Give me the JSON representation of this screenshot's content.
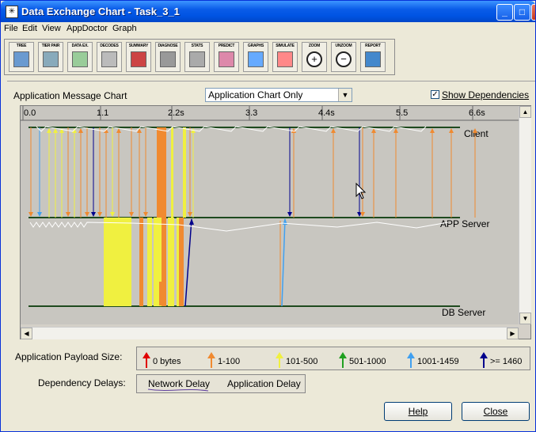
{
  "window": {
    "title": "Data Exchange Chart - Task_3_1",
    "icon": "chart-app-icon"
  },
  "menu": [
    "File",
    "Edit",
    "View",
    "AppDoctor",
    "Graph"
  ],
  "toolbar": [
    {
      "label": "TREE",
      "icon": "tree-icon"
    },
    {
      "label": "TIER PAIR",
      "icon": "tier-pair-icon"
    },
    {
      "label": "DATA EX.",
      "icon": "data-exchange-icon"
    },
    {
      "label": "DECODES",
      "icon": "decodes-icon"
    },
    {
      "label": "SUMMARY",
      "icon": "summary-icon"
    },
    {
      "label": "DIAGNOSE",
      "icon": "diagnose-icon"
    },
    {
      "label": "STATS",
      "icon": "stats-icon"
    },
    {
      "label": "PREDICT",
      "icon": "predict-icon"
    },
    {
      "label": "GRAPHS",
      "icon": "graphs-icon"
    },
    {
      "label": "SIMULATE",
      "icon": "simulate-icon"
    },
    {
      "label": "ZOOM",
      "icon": "zoom-in-icon"
    },
    {
      "label": "UNZOOM",
      "icon": "zoom-out-icon"
    },
    {
      "label": "REPORT",
      "icon": "report-icon"
    }
  ],
  "chart": {
    "title": "Application Message Chart",
    "view_select": "Application Chart Only",
    "show_dependencies_label": "Show Dependencies",
    "show_dependencies_checked": true,
    "time_ticks": [
      "0.0",
      "1.1",
      "2.2s",
      "3.3",
      "4.4s",
      "5.5",
      "6.6s"
    ],
    "tiers": [
      "Client",
      "APP Server",
      "DB Server"
    ]
  },
  "legend": {
    "payload_label": "Application Payload Size:",
    "items": [
      {
        "label": "0 bytes",
        "color": "#e00000"
      },
      {
        "label": "1-100",
        "color": "#f08a30"
      },
      {
        "label": "101-500",
        "color": "#f0f040"
      },
      {
        "label": "501-1000",
        "color": "#20a020"
      },
      {
        "label": "1001-1459",
        "color": "#40a0f0"
      },
      {
        "label": ">= 1460",
        "color": "#00008c"
      }
    ],
    "delay_label": "Dependency Delays:",
    "network_delay": "Network Delay",
    "application_delay": "Application Delay"
  },
  "buttons": {
    "help": "Help",
    "close": "Close"
  },
  "colors": {
    "orange": "#f08a30",
    "yellow": "#f0f040",
    "navy": "#00008c",
    "lightblue": "#40a0f0",
    "tierline": "#1e4a1e",
    "chart_bg": "#c8c6c0"
  }
}
